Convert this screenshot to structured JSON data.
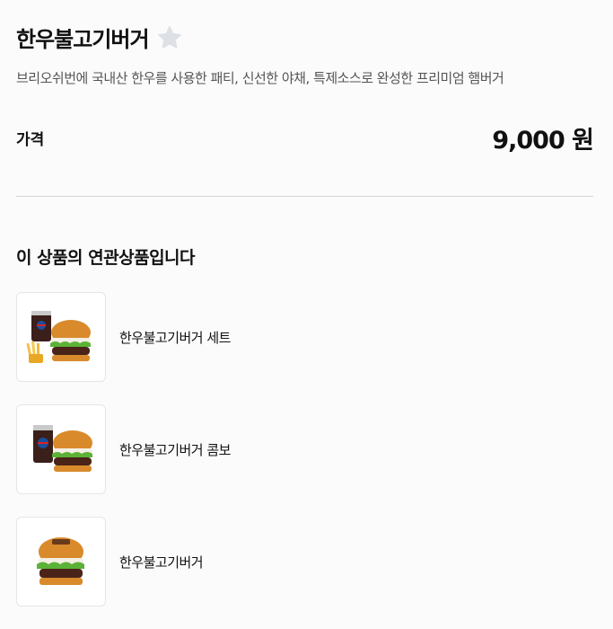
{
  "product": {
    "title": "한우불고기버거",
    "description": "브리오쉬번에 국내산 한우를 사용한 패티, 신선한 야채, 특제소스로 완성한 프리미엄 햄버거",
    "price_label": "가격",
    "price_value": "9,000 원",
    "favorite_icon": "star-icon"
  },
  "related": {
    "title": "이 상품의 연관상품입니다",
    "items": [
      {
        "name": "한우불고기버거 세트",
        "image": "burger-set-image"
      },
      {
        "name": "한우불고기버거 콤보",
        "image": "burger-combo-image"
      },
      {
        "name": "한우불고기버거",
        "image": "burger-image"
      }
    ]
  },
  "colors": {
    "background": "#fbfbfb",
    "divider": "#d4d4d4",
    "star": "#dde1e6"
  }
}
